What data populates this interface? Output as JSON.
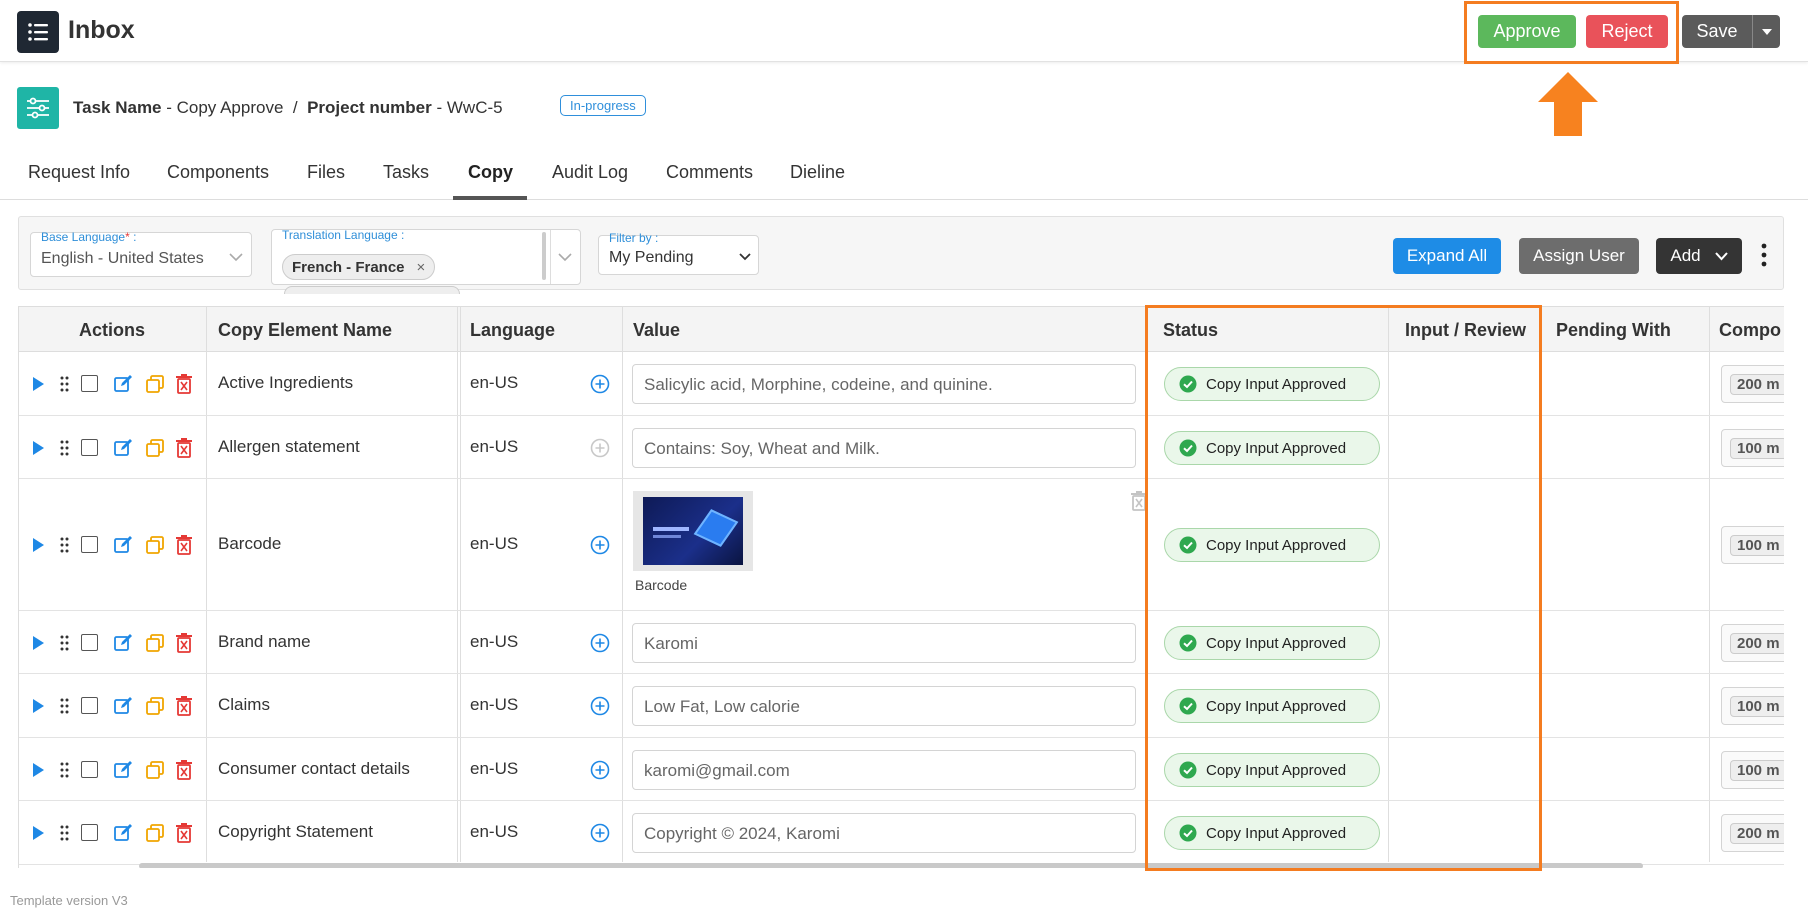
{
  "header": {
    "app_title": "Inbox",
    "approve_label": "Approve",
    "reject_label": "Reject",
    "save_label": "Save"
  },
  "task": {
    "task_name_label": "Task Name",
    "task_name_value": "Copy Approve",
    "separator": "/",
    "project_label": "Project number",
    "project_value": "WwC-5",
    "status": "In-progress"
  },
  "tabs": [
    {
      "label": "Request Info"
    },
    {
      "label": "Components"
    },
    {
      "label": "Files"
    },
    {
      "label": "Tasks"
    },
    {
      "label": "Copy",
      "active": true
    },
    {
      "label": "Audit Log"
    },
    {
      "label": "Comments"
    },
    {
      "label": "Dieline"
    }
  ],
  "filters": {
    "base_language_label": "Base Language",
    "base_language_value": "English - United States",
    "translation_language_label": "Translation Language :",
    "translation_chip": "French - France",
    "filter_by_label": "Filter by :",
    "filter_by_value": "My Pending",
    "expand_all": "Expand All",
    "assign_user": "Assign User",
    "add": "Add"
  },
  "table": {
    "headers": {
      "actions": "Actions",
      "copy_element_name": "Copy Element Name",
      "language": "Language",
      "value": "Value",
      "status": "Status",
      "input_review": "Input / Review",
      "pending_with": "Pending With",
      "component": "Compo"
    },
    "rows": [
      {
        "name": "Active Ingredients",
        "language": "en-US",
        "value": "Salicylic acid, Morphine, codeine, and quinine.",
        "status": "Copy Input Approved",
        "component": "200 m"
      },
      {
        "name": "Allergen statement",
        "language": "en-US",
        "value": "Contains: Soy, Wheat and Milk.",
        "status": "Copy Input Approved",
        "component": "100 m"
      },
      {
        "name": "Barcode",
        "language": "en-US",
        "value": "",
        "image_caption": "Barcode",
        "status": "Copy Input Approved",
        "component": "100 m"
      },
      {
        "name": "Brand name",
        "language": "en-US",
        "value": "Karomi",
        "status": "Copy Input Approved",
        "component": "200 m"
      },
      {
        "name": "Claims",
        "language": "en-US",
        "value": "Low Fat, Low calorie",
        "status": "Copy Input Approved",
        "component": "100 m"
      },
      {
        "name": "Consumer contact details",
        "language": "en-US",
        "value": "karomi@gmail.com",
        "status": "Copy Input Approved",
        "component": "100 m"
      },
      {
        "name": "Copyright Statement",
        "language": "en-US",
        "value": "Copyright © 2024, Karomi",
        "status": "Copy Input Approved",
        "component": "200 m"
      }
    ]
  },
  "footer": {
    "template_version": "Template version V3"
  },
  "colors": {
    "highlight": "#f47c20",
    "approve": "#5cb85c",
    "reject": "#e9525a",
    "primary": "#1e8ce6",
    "teal": "#1fb5a6",
    "status_green": "#2fa84f"
  }
}
